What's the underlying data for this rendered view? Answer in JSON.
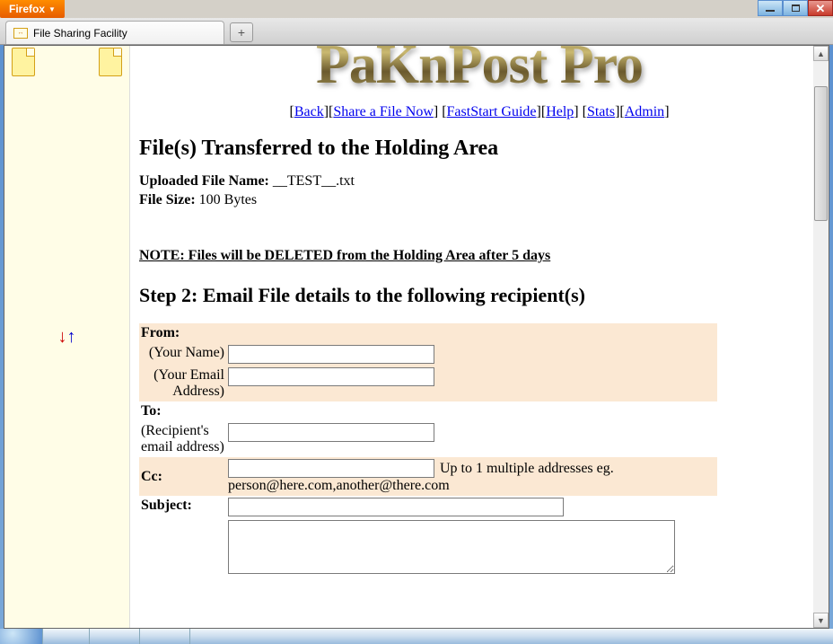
{
  "browser": {
    "name": "Firefox",
    "tab_title": "File Sharing Facility"
  },
  "logo": "PaKnPost Pro",
  "nav": {
    "back": "Back",
    "share": "Share a File Now",
    "guide": "FastStart Guide",
    "help": "Help",
    "stats": "Stats",
    "admin": "Admin"
  },
  "h1": "File(s) Transferred to the Holding Area",
  "file": {
    "name_label": "Uploaded File Name:",
    "name": "__TEST__.txt",
    "size_label": "File Size:",
    "size": "100 Bytes"
  },
  "note": "NOTE: Files will be DELETED from the Holding Area after 5 days",
  "step2": "Step 2: Email File details to the following recipient(s)",
  "form": {
    "from": "From:",
    "your_name": "(Your Name)",
    "your_email": "(Your Email Address)",
    "to": "To:",
    "to_hint": "(Recipient's email address)",
    "cc": "Cc:",
    "cc_hint": "Up to 1 multiple addresses eg. person@here.com,another@there.com",
    "subject": "Subject:"
  }
}
